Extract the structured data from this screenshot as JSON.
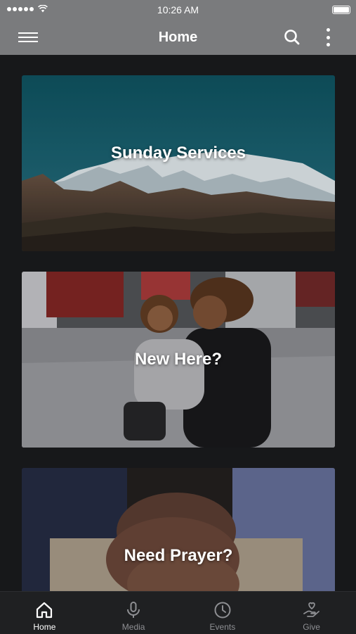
{
  "status_bar": {
    "time": "10:26 AM"
  },
  "header": {
    "title": "Home"
  },
  "cards": [
    {
      "label": "Sunday Services"
    },
    {
      "label": "New Here?"
    },
    {
      "label": "Need Prayer?"
    }
  ],
  "tabs": [
    {
      "label": "Home",
      "icon": "home-icon",
      "active": true
    },
    {
      "label": "Media",
      "icon": "microphone-icon",
      "active": false
    },
    {
      "label": "Events",
      "icon": "clock-icon",
      "active": false
    },
    {
      "label": "Give",
      "icon": "give-hand-heart-icon",
      "active": false
    }
  ],
  "colors": {
    "header_bg": "#7a7b7d",
    "background": "#17181a",
    "tab_active": "#ffffff",
    "tab_inactive": "#8e8f93"
  }
}
